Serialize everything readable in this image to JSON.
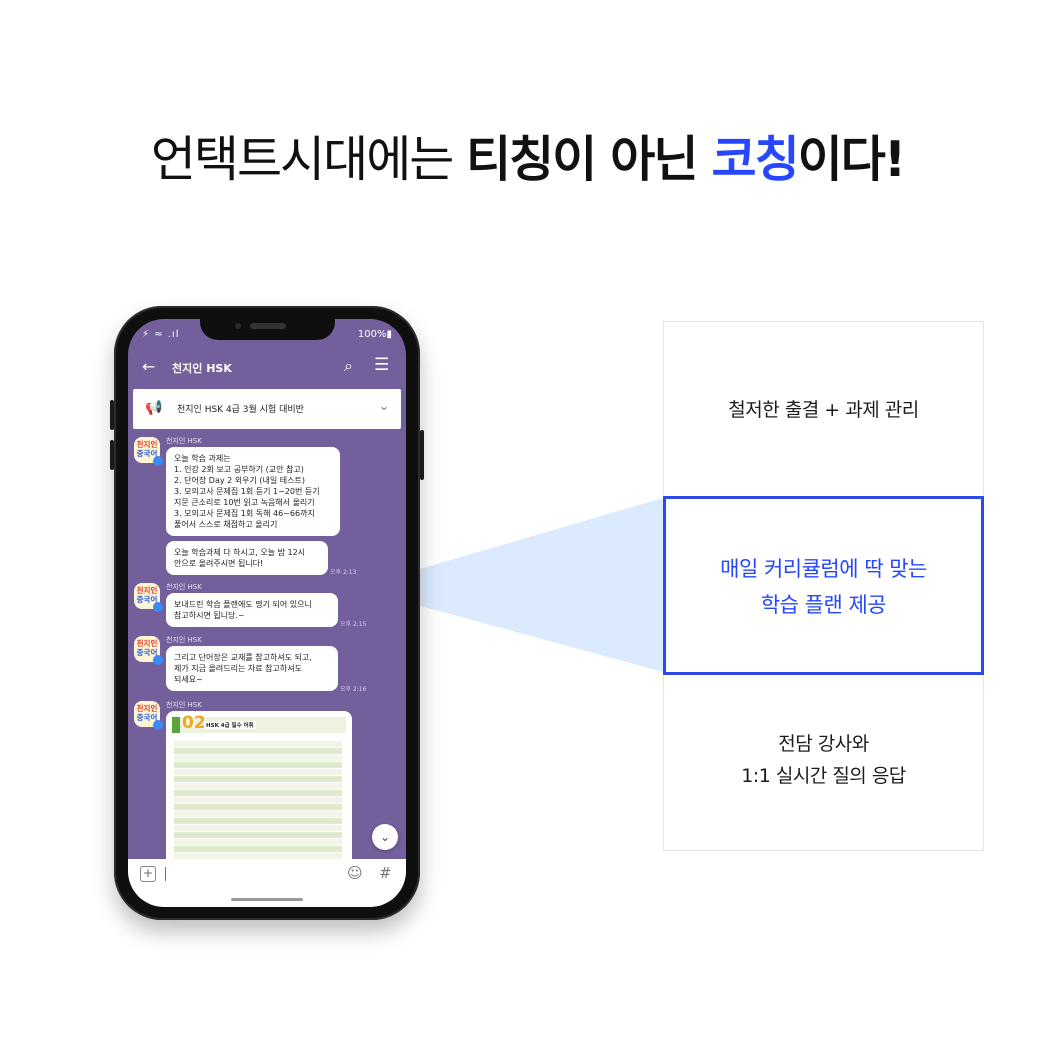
{
  "headline": {
    "light": "언택트시대에는 ",
    "bold1": "티칭이 아닌 ",
    "accent": "코칭",
    "bold2": "이다!"
  },
  "colors": {
    "accent": "#2747ff",
    "chat_bg": "#725f9b",
    "box_border": "#2c49ea"
  },
  "panel": {
    "top": "철저한 출결 + 과제 관리",
    "focus": [
      "매일 커리큘럼에 딱 맞는",
      "학습 플랜 제공"
    ],
    "bottom": [
      "전담 강사와",
      "1:1 실시간 질의 응답"
    ]
  },
  "phone": {
    "status": {
      "left": "⚡ ≈ .ıl",
      "battery": "100%▮"
    },
    "appbar": {
      "title": "천지인 HSK",
      "back_icon": "arrow-left",
      "search_icon": "search",
      "menu_icon": "menu"
    },
    "notice": "천지인 HSK 4급 3월 시험 대비반",
    "avatar": {
      "line1": "천지인",
      "line2": "중국어"
    },
    "messages": [
      {
        "sender": "천지인 HSK",
        "lines": [
          "오늘 학습 과제는",
          "1. 인강 2회 보고 공부하기 (교안 참고)",
          "2. 단어장 Day 2 외우기 (내일 테스트)",
          "3. 모의고사 문제집 1회 듣기 1~20번 듣기",
          "지문 큰소리로 10번 읽고 녹음해서 올리기",
          "3. 모의고사 문제집 1회 독해 46~66까지",
          "풀어서 스스로 채점하고 올리기"
        ]
      },
      {
        "lines": [
          "오늘 학습과제 다 하시고, 오늘 밤 12시",
          "안으로 올려주시면 됩니다!"
        ],
        "time": "오후 2:13"
      },
      {
        "sender": "천지인 HSK",
        "lines": [
          "보내드린 학습 플랜에도 명기 되어 있으니",
          "참고하시면 됩니당.~"
        ],
        "time": "오후 2:15"
      },
      {
        "sender": "천지인 HSK",
        "lines": [
          "그리고 단어장은 교재를 참고하셔도 되고,",
          "제가 지금 올려드리는 자료 참고하셔도",
          "되세요~"
        ],
        "time": "오후 2:16"
      },
      {
        "sender": "천지인 HSK",
        "image": {
          "number": "02",
          "label": "HSK 4급 필수 어휘"
        }
      }
    ]
  }
}
